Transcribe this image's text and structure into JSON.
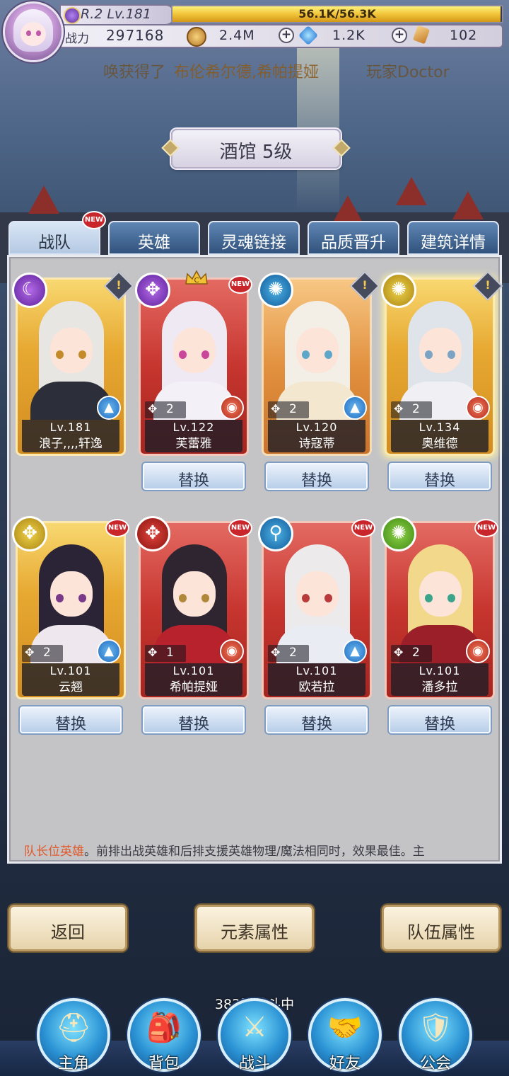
{
  "player": {
    "rank_level": "R.2 Lv.181",
    "exp_text": "56.1K/56.3K",
    "exp_fraction": 0.996,
    "power_label": "战力",
    "power_value": "297168"
  },
  "resources": [
    {
      "icon": "gold-coin-icon",
      "value": "2.4M",
      "color": "#c98b2c"
    },
    {
      "icon": "blue-diamond-icon",
      "value": "1.2K",
      "color": "#2f7fd8"
    },
    {
      "icon": "soul-gem-icon",
      "value": "102",
      "color": "#d89a3a"
    }
  ],
  "ticker": {
    "part1": "唤获得了",
    "part2": "布伦希尔德,希帕提娅",
    "part3": "玩家Doctor"
  },
  "building": {
    "title": "酒馆 5级"
  },
  "tabs": [
    {
      "label": "战队",
      "active": true,
      "new_badge": "NEW"
    },
    {
      "label": "英雄"
    },
    {
      "label": "灵魂链接"
    },
    {
      "label": "品质晋升"
    },
    {
      "label": "建筑详情"
    }
  ],
  "heroes": [
    {
      "name": "浪子,,,,轩逸",
      "level": "Lv.181",
      "star": "",
      "frame": "gold",
      "class_icon": "moon-icon",
      "type": "mage",
      "alert": "!",
      "new_badge": "",
      "crown": "",
      "swap": ""
    },
    {
      "name": "芙蕾雅",
      "level": "Lv.122",
      "star": "2",
      "frame": "red",
      "class_icon": "wing-icon",
      "type": "war",
      "alert": "",
      "new_badge": "NEW",
      "crown": "C",
      "swap": "替换"
    },
    {
      "name": "诗寇蒂",
      "level": "Lv.120",
      "star": "2",
      "frame": "orange",
      "class_icon": "shuriken-icon",
      "type": "mage",
      "alert": "!",
      "new_badge": "",
      "crown": "",
      "swap": "替换"
    },
    {
      "name": "奥维德",
      "level": "Lv.134",
      "star": "2",
      "frame": "gold",
      "class_icon": "shuriken-icon",
      "type": "war",
      "alert": "!",
      "new_badge": "",
      "crown": "",
      "swap": "替换"
    },
    {
      "name": "云翘",
      "level": "Lv.101",
      "star": "2",
      "frame": "gold",
      "class_icon": "wing-icon",
      "type": "mage",
      "alert": "",
      "new_badge": "NEW",
      "crown": "",
      "swap": "替换"
    },
    {
      "name": "希帕提娅",
      "level": "Lv.101",
      "star": "1",
      "frame": "red",
      "class_icon": "wing-icon",
      "type": "war",
      "alert": "",
      "new_badge": "NEW",
      "crown": "",
      "swap": "替换"
    },
    {
      "name": "欧若拉",
      "level": "Lv.101",
      "star": "2",
      "frame": "red",
      "class_icon": "magnifier-icon",
      "type": "mage",
      "alert": "",
      "new_badge": "NEW",
      "crown": "",
      "swap": "替换"
    },
    {
      "name": "潘多拉",
      "level": "Lv.101",
      "star": "2",
      "frame": "red",
      "class_icon": "shuriken-icon",
      "type": "war",
      "alert": "",
      "new_badge": "NEW",
      "crown": "",
      "swap": "替换"
    }
  ],
  "tip": {
    "highlight": "队长位英雄",
    "text": "。前排出战英雄和后排支援英雄物理/魔法相同时，效果最佳。主"
  },
  "buttons": {
    "back": "返回",
    "element": "元素属性",
    "team": "队伍属性"
  },
  "status": "383层战斗中",
  "nav": [
    {
      "label": "主角",
      "icon": "helmet-icon"
    },
    {
      "label": "背包",
      "icon": "backpack-icon"
    },
    {
      "label": "战斗",
      "icon": "crossed-swords-icon"
    },
    {
      "label": "好友",
      "icon": "handshake-icon"
    },
    {
      "label": "公会",
      "icon": "guild-crest-icon"
    }
  ]
}
